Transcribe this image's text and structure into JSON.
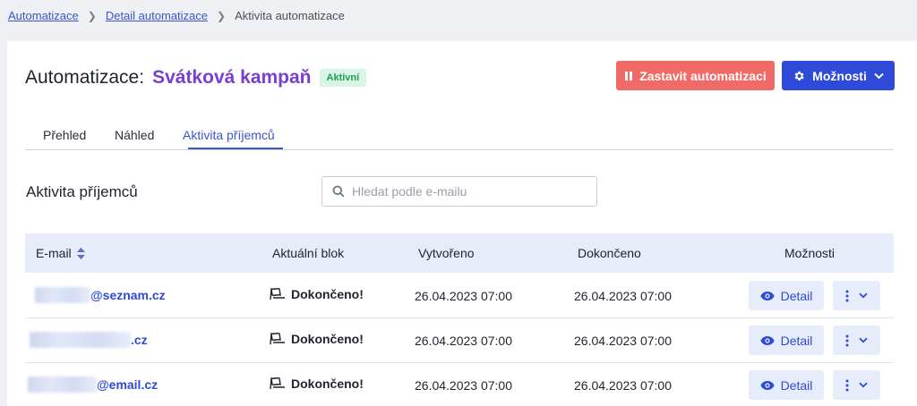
{
  "breadcrumb": {
    "items": [
      {
        "label": "Automatizace"
      },
      {
        "label": "Detail automatizace"
      }
    ],
    "current": "Aktivita automatizace"
  },
  "header": {
    "title_label": "Automatizace:",
    "title_name": "Svátková kampaň",
    "status_badge": "Aktivní",
    "stop_button": "Zastavit automatizaci",
    "options_button": "Možnosti"
  },
  "tabs": [
    {
      "label": "Přehled"
    },
    {
      "label": "Náhled"
    },
    {
      "label": "Aktivita příjemců",
      "active": true
    }
  ],
  "section": {
    "title": "Aktivita příjemců",
    "search_placeholder": "Hledat podle e-mailu"
  },
  "table": {
    "columns": {
      "email": "E-mail",
      "block": "Aktuální blok",
      "created": "Vytvořeno",
      "completed": "Dokončeno",
      "options": "Možnosti"
    },
    "rows": [
      {
        "email_suffix": "@seznam.cz",
        "block": "Dokončeno!",
        "created": "26.04.2023 07:00",
        "completed": "26.04.2023 07:00",
        "detail_label": "Detail"
      },
      {
        "email_suffix": ".cz",
        "block": "Dokončeno!",
        "created": "26.04.2023 07:00",
        "completed": "26.04.2023 07:00",
        "detail_label": "Detail"
      },
      {
        "email_suffix": "@email.cz",
        "block": "Dokončeno!",
        "created": "26.04.2023 07:00",
        "completed": "26.04.2023 07:00",
        "detail_label": "Detail"
      }
    ]
  },
  "colors": {
    "accent": "#2f49d8",
    "purple": "#7a3ed1",
    "danger": "#f06a67",
    "success_bg": "#d9f5e4",
    "success_text": "#1f9d55",
    "header_bg": "#e6ecf9"
  },
  "icons": {
    "breadcrumb_separator": "chevron-right-icon",
    "stop": "pause-icon",
    "options": "gear-icon",
    "dropdown": "chevron-down-icon",
    "search": "search-icon",
    "sort": "sort-icon",
    "block": "finish-flag-icon",
    "detail": "eye-icon",
    "more": "kebab-icon"
  }
}
